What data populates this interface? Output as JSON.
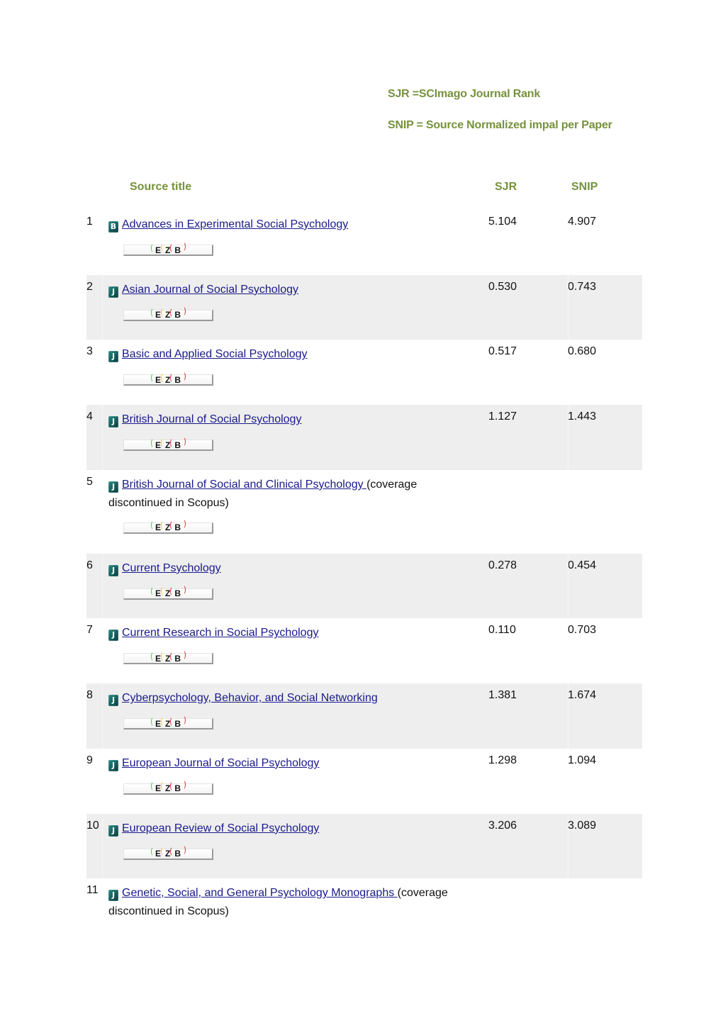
{
  "legend": {
    "sjr_definition": "SJR =SCImago Journal Rank",
    "snip_definition": "SNIP = Source Normalized impal per Paper"
  },
  "colors": {
    "heading_green": "#76923c",
    "link_blue": "#1a1a8c",
    "alt_row_gray": "#eeeeee"
  },
  "table": {
    "headers": {
      "title": "Source title",
      "sjr": "SJR",
      "snip": "SNIP"
    },
    "ezb_label": {
      "e": "E",
      "z": "Z",
      "b": "B"
    },
    "rows": [
      {
        "num": "1",
        "icon": "book-series-icon",
        "icon_glyph": "B",
        "title": "Advances in Experimental Social Psychology",
        "note": "",
        "sjr": "5.104",
        "snip": "4.907"
      },
      {
        "num": "2",
        "icon": "journal-icon",
        "icon_glyph": "J",
        "title": "Asian Journal of Social Psychology",
        "note": "",
        "sjr": "0.530",
        "snip": "0.743"
      },
      {
        "num": "3",
        "icon": "journal-icon",
        "icon_glyph": "J",
        "title": "Basic and Applied Social Psychology",
        "note": "",
        "sjr": "0.517",
        "snip": "0.680"
      },
      {
        "num": "4",
        "icon": "journal-icon",
        "icon_glyph": "J",
        "title": "British Journal of Social Psychology",
        "note": "",
        "sjr": "1.127",
        "snip": "1.443"
      },
      {
        "num": "5",
        "icon": "journal-icon",
        "icon_glyph": "J",
        "title": "British Journal of Social and Clinical Psychology ",
        "note": "(coverage discontinued in Scopus)",
        "sjr": "",
        "snip": ""
      },
      {
        "num": "6",
        "icon": "journal-icon",
        "icon_glyph": "J",
        "title": "Current Psychology",
        "note": "",
        "sjr": "0.278",
        "snip": "0.454"
      },
      {
        "num": "7",
        "icon": "journal-icon",
        "icon_glyph": "J",
        "title": "Current Research in Social Psychology",
        "note": "",
        "sjr": "0.110",
        "snip": "0.703"
      },
      {
        "num": "8",
        "icon": "journal-icon",
        "icon_glyph": "J",
        "title": "Cyberpsychology, Behavior, and Social Networking",
        "note": "",
        "sjr": "1.381",
        "snip": "1.674"
      },
      {
        "num": "9",
        "icon": "journal-icon",
        "icon_glyph": "J",
        "title": "European Journal of Social Psychology",
        "note": "",
        "sjr": "1.298",
        "snip": "1.094"
      },
      {
        "num": "10",
        "icon": "journal-icon",
        "icon_glyph": "J",
        "title": "European Review of Social Psychology",
        "note": "",
        "sjr": "3.206",
        "snip": "3.089"
      },
      {
        "num": "11",
        "icon": "journal-icon",
        "icon_glyph": "J",
        "title": "Genetic, Social, and General Psychology Monographs ",
        "note": "(coverage discontinued in Scopus)",
        "sjr": "",
        "snip": ""
      }
    ]
  }
}
